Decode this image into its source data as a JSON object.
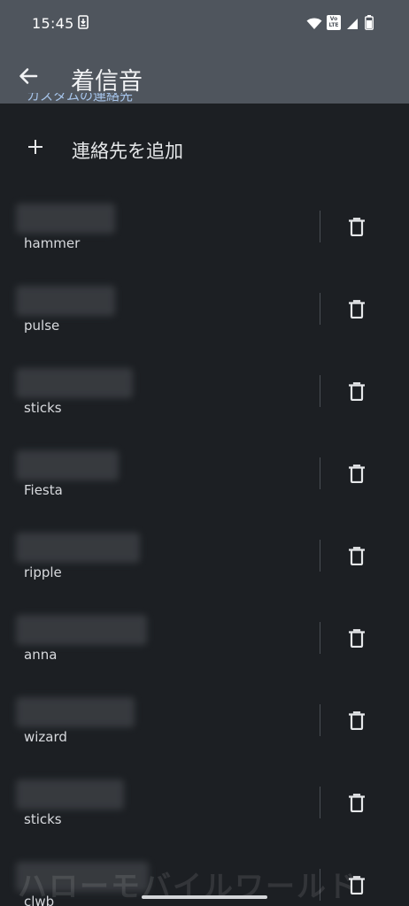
{
  "status_bar": {
    "time": "15:45",
    "volte_label": "Vo LTE"
  },
  "app_bar": {
    "title": "着信音"
  },
  "section_header_partial": "カスタムの連絡先",
  "add_contact_label": "連絡先を追加",
  "contacts": [
    {
      "ringtone": "hammer"
    },
    {
      "ringtone": "pulse"
    },
    {
      "ringtone": "sticks"
    },
    {
      "ringtone": "Fiesta"
    },
    {
      "ringtone": "ripple"
    },
    {
      "ringtone": "anna"
    },
    {
      "ringtone": "wizard"
    },
    {
      "ringtone": "sticks"
    },
    {
      "ringtone": "clwb"
    }
  ],
  "watermark": "ハローモバイルワールド",
  "colors": {
    "app_bar": "#4f555d",
    "background": "#1c1f23",
    "accent_link": "#a6c4ea"
  }
}
